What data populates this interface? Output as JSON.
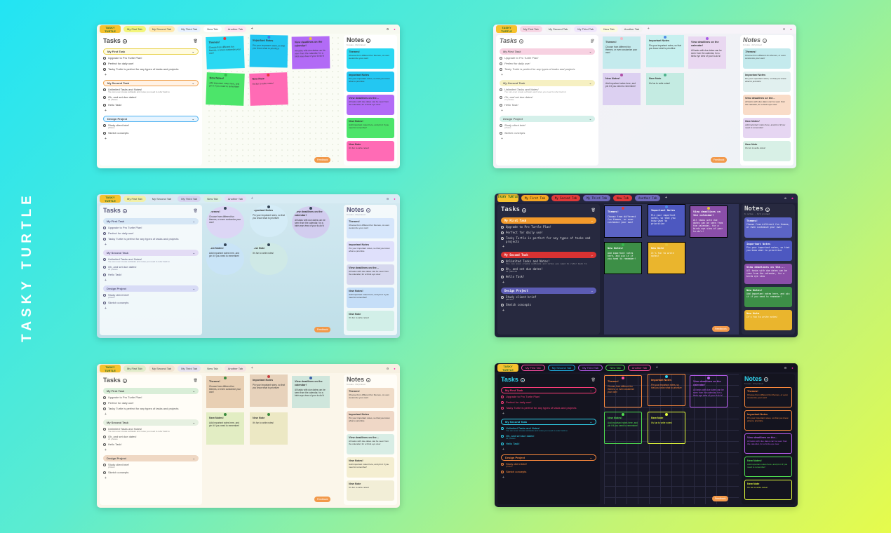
{
  "brand": "TASKY TURTLE",
  "logo_text": "TASKY TURTLE",
  "tabs": [
    "My First Tab",
    "My Second Tab",
    "My Third Tab",
    "New Tab",
    "Another Tab"
  ],
  "tasks_title": "Tasks",
  "notes_title": "Notes",
  "notes_subtitle": "6 notes · 0/2 pinned",
  "feedback_label": "Feedback",
  "groups": [
    {
      "name": "My First Task",
      "items": [
        {
          "text": "Upgrade to Pro Turtle Plan!",
          "sub": ""
        },
        {
          "text": "Perfect for daily use!",
          "sub": ""
        },
        {
          "text": "Tasky Turtle is perfect for any types of tasks and projects",
          "sub": ""
        }
      ]
    },
    {
      "name": "My Second Task",
      "items": [
        {
          "text": "Unlimited Tasks and Notes!",
          "sub": "You can even create subtasks and notes you need to refer back to"
        },
        {
          "text": "Oh, and set due dates!",
          "sub": "21 pNotes"
        },
        {
          "text": "Hello Task!",
          "sub": ""
        }
      ]
    },
    {
      "name": "Design Project",
      "items": [
        {
          "text": "Study client brief",
          "sub": "pNotes"
        },
        {
          "text": "Sketch concepts",
          "sub": ""
        }
      ]
    }
  ],
  "stickies": [
    {
      "title": "Themes!",
      "body": "Choose from different fun themes, or even customize your own!"
    },
    {
      "title": "Important Notes",
      "body": "Pin your important notes, so that you know what to prioritize"
    },
    {
      "title": "View deadlines on the calendar!",
      "body": "All tasks with due dates can be seen from the calendar, for a birds eye view of your to-do's!"
    },
    {
      "title": "New Notes!",
      "body": "Add important notes here, and pin it if you need to remember!"
    },
    {
      "title": "New Note",
      "body": "It's fun to write notes!"
    }
  ],
  "note_cards": [
    {
      "title": "Themes!",
      "body": "Choose from different fun themes, or even customize your own!"
    },
    {
      "title": "Important Notes",
      "body": "Pin your important notes, so that you know what to prioritize"
    },
    {
      "title": "View deadlines on the...",
      "body": "All tasks with due dates can be seen from the calendar, for a birds eye view"
    },
    {
      "title": "New Notes!",
      "body": "Add important notes here, and pin it if you need to remember!"
    },
    {
      "title": "New Note",
      "body": "It's fun to write notes!"
    }
  ],
  "themes": [
    {
      "id": "light",
      "tab_colors": [
        "#f3f57a",
        "#ffe8ad",
        "#e8f1ff",
        "#fff",
        "#ffe6f2"
      ],
      "group_colors": [
        "#fffbe0",
        "#fff2e6",
        "#e6f4ff"
      ],
      "sticky_colors": [
        "#2ad8f2",
        "#23c7f2",
        "#b26bf6",
        "#4ce56a",
        "#ff6bb5"
      ],
      "pin_colors": [
        "#e63939",
        "#3d7ce6",
        "#e6c539",
        "#36b84d",
        "#e63939"
      ],
      "card_colors": [
        "#2ad8f2",
        "#23c7f2",
        "#b26bf6",
        "#4ce56a",
        "#ff6bb5"
      ],
      "text": "#333"
    },
    {
      "id": "pastel",
      "tab_colors": [
        "#f7d6e4",
        "#f3f3f3",
        "#efe6fb",
        "#fbfbe0",
        "#f3f3f3"
      ],
      "group_colors": [
        "#f7d1e1",
        "#f6f0c2",
        "#d5f0ea"
      ],
      "sticky_colors": [
        "#c4eaed",
        "#c7f0ef",
        "#e9d8f1",
        "#dcd0f1",
        "#c4ebe2"
      ],
      "pin_colors": [
        "#f2b8c6",
        "#4d8be6",
        "#a85ce6",
        "#b04fa5",
        "#4db08a"
      ],
      "card_colors": [
        "#c4eaed",
        "#e1f0ef",
        "#f9dcc8",
        "#e6d6f2",
        "#d8f0e6"
      ],
      "text": "#666"
    },
    {
      "id": "ocean",
      "tab_colors": [
        "#f2f0a8",
        "#dde8f2",
        "#d8d4f0",
        "#d9f0e1",
        "#e6dcf5"
      ],
      "group_colors": [
        "#d5e6f5",
        "#e3dcf5",
        "#d8dcf6"
      ],
      "sticky_colors": [
        "#dcd6f5",
        "#d4ecf7",
        "#d2cdef",
        "#c9e4f7",
        "#cfe9e6"
      ],
      "pin_colors": [
        "#345",
        "#345",
        "#345",
        "#345",
        "#345"
      ],
      "card_colors": [
        "#d6e6fb",
        "#dfe0fb",
        "#d6d8ee",
        "#c5def8",
        "#d2efe8"
      ],
      "text": "#557"
    },
    {
      "id": "pixel",
      "tab_colors": [
        "#f5a623",
        "#e03a3a",
        "#6d68b8",
        "#e03a3a",
        "#6d68b8"
      ],
      "group_colors": [
        "#f39a2b",
        "#d93232",
        "#5c5cb4"
      ],
      "sticky_colors": [
        "#5c64c5",
        "#4d58c0",
        "#8a4ea8",
        "#3d8f47",
        "#eab52d"
      ],
      "pin_colors": [
        "#e03a3a",
        "#4d8be6",
        "#e6c539",
        "#36b84d",
        "#e6c539"
      ],
      "card_colors": [
        "#5c64c5",
        "#4d58c0",
        "#8a4ea8",
        "#3d8f47",
        "#eab52d"
      ],
      "text": "#eee"
    },
    {
      "id": "vintage",
      "tab_colors": [
        "#e1ecca",
        "#f2e4d2",
        "#e6e2f0",
        "#f1f0e1",
        "#f5e3e3"
      ],
      "group_colors": [
        "#d9eed8",
        "#e6f0e1",
        "#efd8c4"
      ],
      "sticky_colors": [
        "#e8cfb3",
        "#e7d2bb",
        "#cfe6dc",
        "#e2edc3",
        "#ece8c4"
      ],
      "pin_colors": [
        "#3b8a3e",
        "#c84040",
        "#3b5fa8",
        "#3b8a3e",
        "#3b8a3e"
      ],
      "card_colors": [
        "#f0dcc8",
        "#efd7c6",
        "#d8ede5",
        "#f4eed1",
        "#f2eed7"
      ],
      "text": "#555"
    },
    {
      "id": "neon",
      "tab_colors": [
        "#ff4ea3",
        "#20b5e8",
        "#ba5cf0",
        "#50e050",
        "#ff4ea3"
      ],
      "group_colors": [
        "#ff3d7a",
        "#31d7f2",
        "#ff8b3d"
      ],
      "sticky_colors": [
        "#ff8b3d",
        "#ff8b3d",
        "#ba5cf0",
        "#50e050",
        "#e6ff3d"
      ],
      "pin_colors": [
        "#ff4ea3",
        "#31d7f2",
        "#ba5cf0",
        "#50e050",
        "#e6ff3d"
      ],
      "card_colors": [
        "#ff8b3d",
        "#ff8b3d",
        "#ba5cf0",
        "#50e050",
        "#e6ff3d"
      ],
      "text": "#ddd"
    }
  ]
}
